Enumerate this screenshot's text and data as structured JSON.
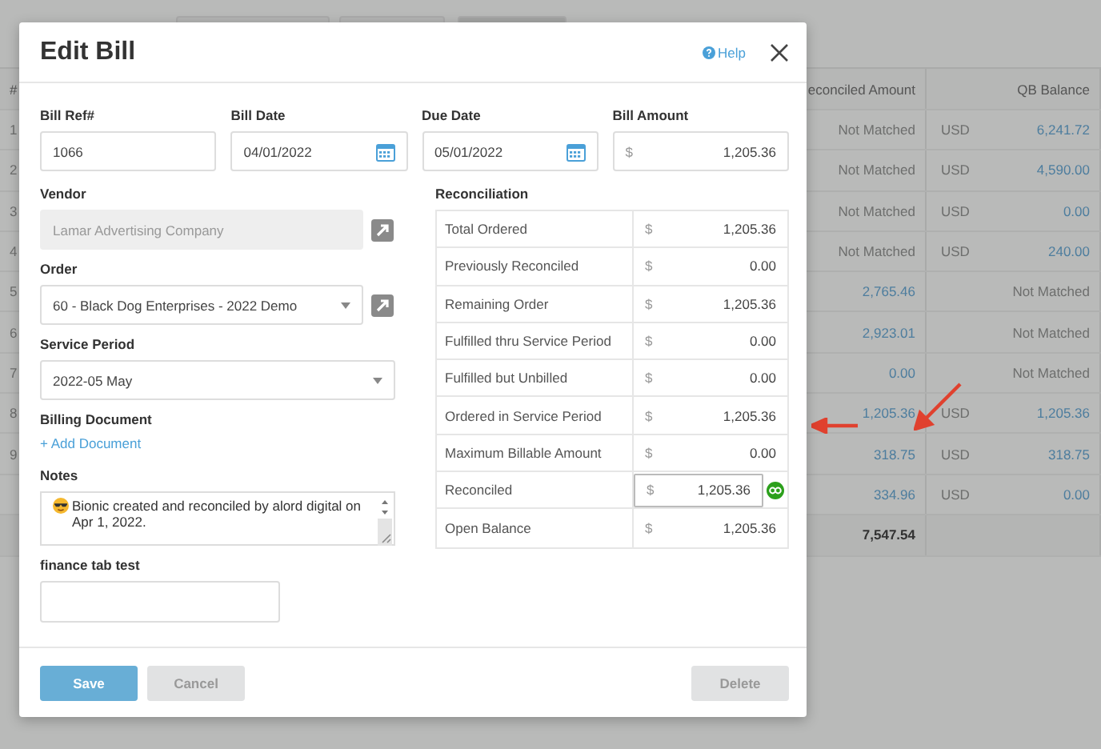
{
  "background_table": {
    "header": {
      "number": "#",
      "reconciled": "econciled Amount",
      "qb_balance": "QB Balance"
    },
    "rows": [
      {
        "number": "1",
        "reconciled": {
          "text": "Not Matched",
          "link": false
        },
        "currency": "USD",
        "qb_balance": {
          "text": "6,241.72",
          "link": true
        }
      },
      {
        "number": "2",
        "reconciled": {
          "text": "Not Matched",
          "link": false
        },
        "currency": "USD",
        "qb_balance": {
          "text": "4,590.00",
          "link": true
        }
      },
      {
        "number": "3",
        "reconciled": {
          "text": "Not Matched",
          "link": false
        },
        "currency": "USD",
        "qb_balance": {
          "text": "0.00",
          "link": true
        }
      },
      {
        "number": "4",
        "reconciled": {
          "text": "Not Matched",
          "link": false
        },
        "currency": "USD",
        "qb_balance": {
          "text": "240.00",
          "link": true
        }
      },
      {
        "number": "5",
        "reconciled": {
          "text": "2,765.46",
          "link": true
        },
        "qb_balance": {
          "text": "Not Matched",
          "link": false
        }
      },
      {
        "number": "6",
        "reconciled": {
          "text": "2,923.01",
          "link": true
        },
        "qb_balance": {
          "text": "Not Matched",
          "link": false
        }
      },
      {
        "number": "7",
        "reconciled": {
          "text": "0.00",
          "link": true
        },
        "qb_balance": {
          "text": "Not Matched",
          "link": false
        }
      },
      {
        "number": "8",
        "reconciled": {
          "text": "1,205.36",
          "link": true
        },
        "currency": "USD",
        "qb_balance": {
          "text": "1,205.36",
          "link": true
        }
      },
      {
        "number": "9",
        "reconciled": {
          "text": "318.75",
          "link": true
        },
        "currency": "USD",
        "qb_balance": {
          "text": "318.75",
          "link": true
        }
      },
      {
        "reconciled": {
          "text": "334.96",
          "link": true
        },
        "currency": "USD",
        "qb_balance": {
          "text": "0.00",
          "link": true
        }
      }
    ],
    "total": "7,547.54"
  },
  "dialog": {
    "title": "Edit Bill",
    "help": "Help",
    "top_fields": [
      {
        "label": "Bill Ref#",
        "kind": "text",
        "value": "1066"
      },
      {
        "label": "Bill Date",
        "kind": "date",
        "value": "04/01/2022"
      },
      {
        "label": "Due Date",
        "kind": "date",
        "value": "05/01/2022"
      },
      {
        "label": "Bill Amount",
        "kind": "money",
        "currency": "$",
        "value": "1,205.36"
      }
    ],
    "vendor": {
      "label": "Vendor",
      "value": "Lamar Advertising Company",
      "disabled": true
    },
    "order": {
      "label": "Order",
      "value": "60 - Black Dog Enterprises - 2022 Demo"
    },
    "service_period": {
      "label": "Service Period",
      "value": "2022-05 May"
    },
    "billing_document": {
      "label": "Billing Document",
      "add_link": "+ Add Document"
    },
    "notes": {
      "label": "Notes",
      "value": "Bionic created and reconciled by alord digital on Apr 1, 2022."
    },
    "finance_tab_test": {
      "label": "finance tab test"
    },
    "reconciliation": {
      "title": "Reconciliation",
      "rows": [
        {
          "label": "Total Ordered",
          "currency": "$",
          "value": "1,205.36",
          "kind": "static"
        },
        {
          "label": "Previously Reconciled",
          "currency": "$",
          "value": "0.00",
          "kind": "static"
        },
        {
          "label": "Remaining Order",
          "currency": "$",
          "value": "1,205.36",
          "kind": "static"
        },
        {
          "label": "Fulfilled thru Service Period",
          "currency": "$",
          "value": "0.00",
          "kind": "static"
        },
        {
          "label": "Fulfilled but Unbilled",
          "currency": "$",
          "value": "0.00",
          "kind": "static"
        },
        {
          "label": "Ordered in Service Period",
          "currency": "$",
          "value": "1,205.36",
          "kind": "static"
        },
        {
          "label": "Maximum Billable Amount",
          "currency": "$",
          "value": "0.00",
          "kind": "static"
        },
        {
          "label": "Reconciled",
          "currency": "$",
          "value": "1,205.36",
          "kind": "input"
        },
        {
          "label": "Open Balance",
          "currency": "$",
          "value": "1,205.36",
          "kind": "static"
        }
      ]
    },
    "buttons": [
      {
        "label": "Save",
        "kind": "primary"
      },
      {
        "label": "Cancel",
        "kind": "secondary"
      },
      {
        "label": "Delete",
        "kind": "secondary"
      }
    ]
  }
}
